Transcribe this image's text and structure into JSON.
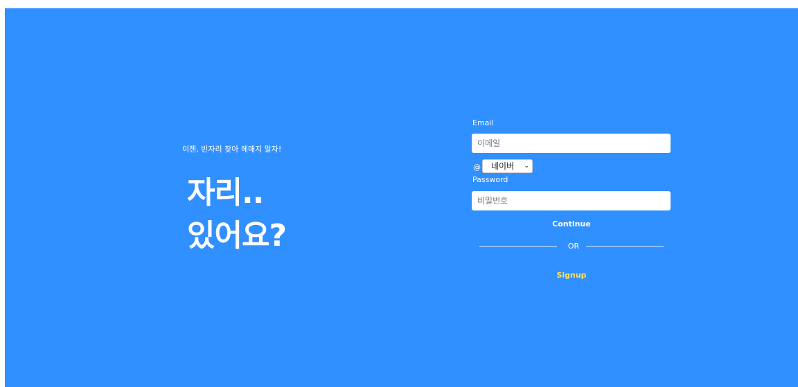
{
  "hero": {
    "tagline": "이젠, 빈자리 찾아 헤매지 말자!",
    "headline_line1": "자리..",
    "headline_line2": "있어요?"
  },
  "form": {
    "email_label": "Email",
    "email_placeholder": "이메일",
    "at_symbol": "@",
    "domain_selected": "네이버",
    "password_label": "Password",
    "password_placeholder": "비밀번호",
    "continue_label": "Continue",
    "or_text": "OR",
    "signup_label": "Signup"
  },
  "colors": {
    "background": "#3090ff",
    "signup_link": "#ffe066"
  }
}
